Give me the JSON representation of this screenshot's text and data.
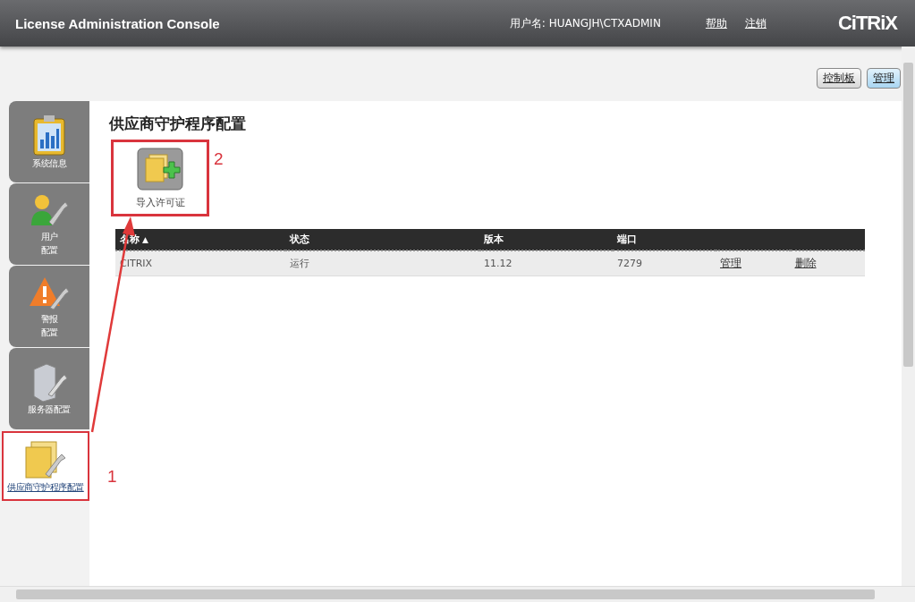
{
  "header": {
    "title": "License Administration Console",
    "user": "用户名: HUANGJH\\CTXADMIN",
    "links": [
      "帮助",
      "注销"
    ],
    "logo": "CiTRiX"
  },
  "top_buttons": [
    {
      "label": "控制板",
      "selected": false
    },
    {
      "label": "管理",
      "selected": true
    }
  ],
  "sidebar": {
    "items": [
      {
        "lines": [
          "系统信息"
        ],
        "kind": "chart",
        "selected": false,
        "highlighted": false
      },
      {
        "lines": [
          "用户",
          "配置"
        ],
        "kind": "user",
        "selected": false,
        "highlighted": false
      },
      {
        "lines": [
          "警报",
          "配置"
        ],
        "kind": "warning",
        "selected": false,
        "highlighted": false
      },
      {
        "lines": [
          "服务器配置"
        ],
        "kind": "server",
        "selected": false,
        "highlighted": false
      },
      {
        "lines": [
          "供应商守护程序配置"
        ],
        "kind": "folder",
        "selected": true,
        "highlighted": true,
        "annotation": "1"
      }
    ]
  },
  "content": {
    "title": "供应商守护程序配置",
    "import_button": {
      "label": "导入许可证",
      "highlighted": true,
      "annotation": "2"
    },
    "table": {
      "columns": [
        {
          "label": "名称",
          "sort_arrow": "▲"
        },
        {
          "label": "状态"
        },
        {
          "label": "版本"
        },
        {
          "label": "端口"
        }
      ],
      "rows": [
        {
          "cells": [
            "CITRIX",
            "运行",
            "11.12",
            "7279"
          ],
          "actions": [
            "管理",
            "删除"
          ]
        }
      ]
    }
  }
}
